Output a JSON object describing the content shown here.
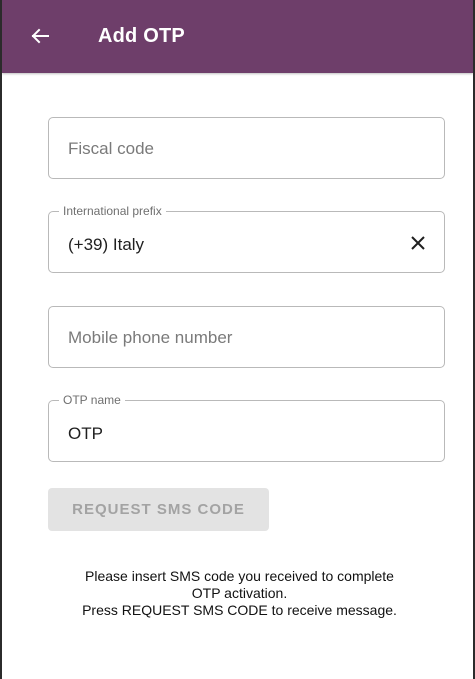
{
  "header": {
    "title": "Add OTP",
    "back_icon": "arrow-left-icon",
    "color": "#6e3e6a"
  },
  "form": {
    "fiscal_code": {
      "placeholder": "Fiscal code",
      "value": ""
    },
    "international_prefix": {
      "label": "International prefix",
      "value": "(+39) Italy",
      "clear_icon": "close-icon"
    },
    "mobile_phone": {
      "placeholder": "Mobile phone number",
      "value": ""
    },
    "otp_name": {
      "label": "OTP name",
      "value": "OTP"
    }
  },
  "actions": {
    "request_sms_label": "REQUEST SMS CODE",
    "request_sms_enabled": false
  },
  "info": {
    "line1": "Please insert SMS code you received to complete",
    "line2": "OTP activation.",
    "line3": "Press REQUEST SMS CODE to receive message."
  }
}
